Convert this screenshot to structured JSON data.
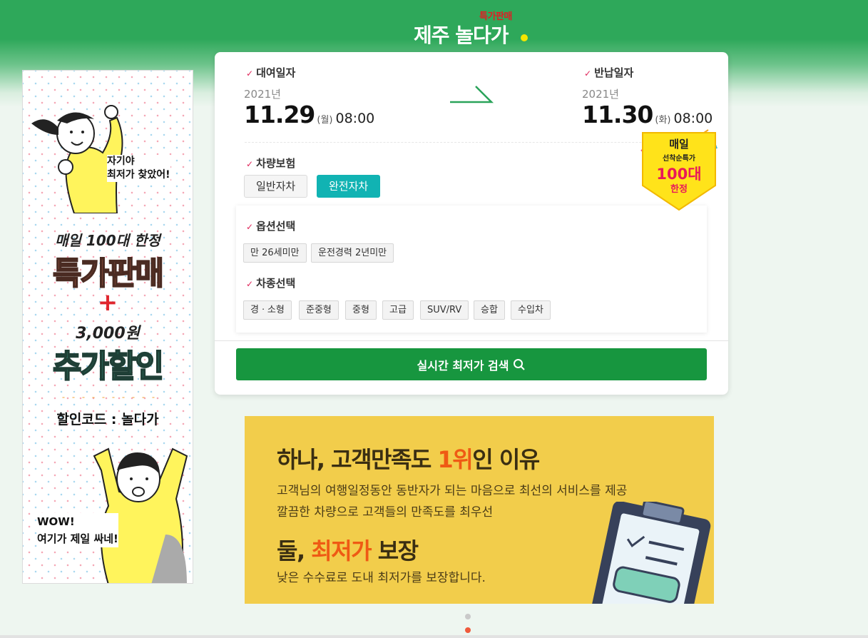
{
  "header": {
    "logo_main": "제주 놀다가",
    "logo_badge": "특가판매"
  },
  "side_banner": {
    "bubble": [
      "자기야",
      "최저가 찾았어!"
    ],
    "line1": "매일 100대 한정",
    "big1": "특가판매",
    "plus": "+",
    "line2": "3,000원",
    "big2": "추가할인",
    "code": "할인코드 : 놀다가",
    "wow": [
      "WOW!",
      "여기가 제일 싸네!"
    ]
  },
  "rental": {
    "pickup_label": "대여일자",
    "pickup_year": "2021년",
    "pickup_date": "11.29",
    "pickup_dow": "(월)",
    "pickup_time": "08:00",
    "return_label": "반납일자",
    "return_year": "2021년",
    "return_date": "11.30",
    "return_dow": "(화)",
    "return_time": "08:00"
  },
  "insurance": {
    "label": "차량보험",
    "options": [
      "일반자차",
      "완전자차"
    ],
    "selected": "완전자차"
  },
  "options": {
    "label": "옵션선택",
    "chips": [
      "만 26세미만",
      "운전경력 2년미만"
    ]
  },
  "car_types": {
    "label": "차종선택",
    "chips": [
      "경ㆍ소형",
      "준중형",
      "중형",
      "고급",
      "SUV/RV",
      "승합",
      "수입차"
    ]
  },
  "search_button": "실시간 최저가 검색",
  "sticker": {
    "line1": "매일",
    "line2": "선착순특가",
    "line3": "100대",
    "line4": "한정"
  },
  "promo": {
    "h1_pre": "하나, 고객만족도 ",
    "h1_hl": "1위",
    "h1_post": "인 이유",
    "p1": "고객님의 여행일정동안 동반자가 되는 마음으로 최선의 서비스를 제공",
    "p2": "깔끔한 차량으로 고객들의 만족도를 최우선",
    "h2_pre": "둘, ",
    "h2_hl": "최저가",
    "h2_post": " 보장",
    "p3": "낮은 수수료로 도내 최저가를 보장합니다."
  },
  "colors": {
    "brand_green": "#2ea85a",
    "search_button": "#17963f",
    "insurance_active": "#11b3b3",
    "promo_bg": "#f2cd4b",
    "highlight": "#ef5a14"
  }
}
